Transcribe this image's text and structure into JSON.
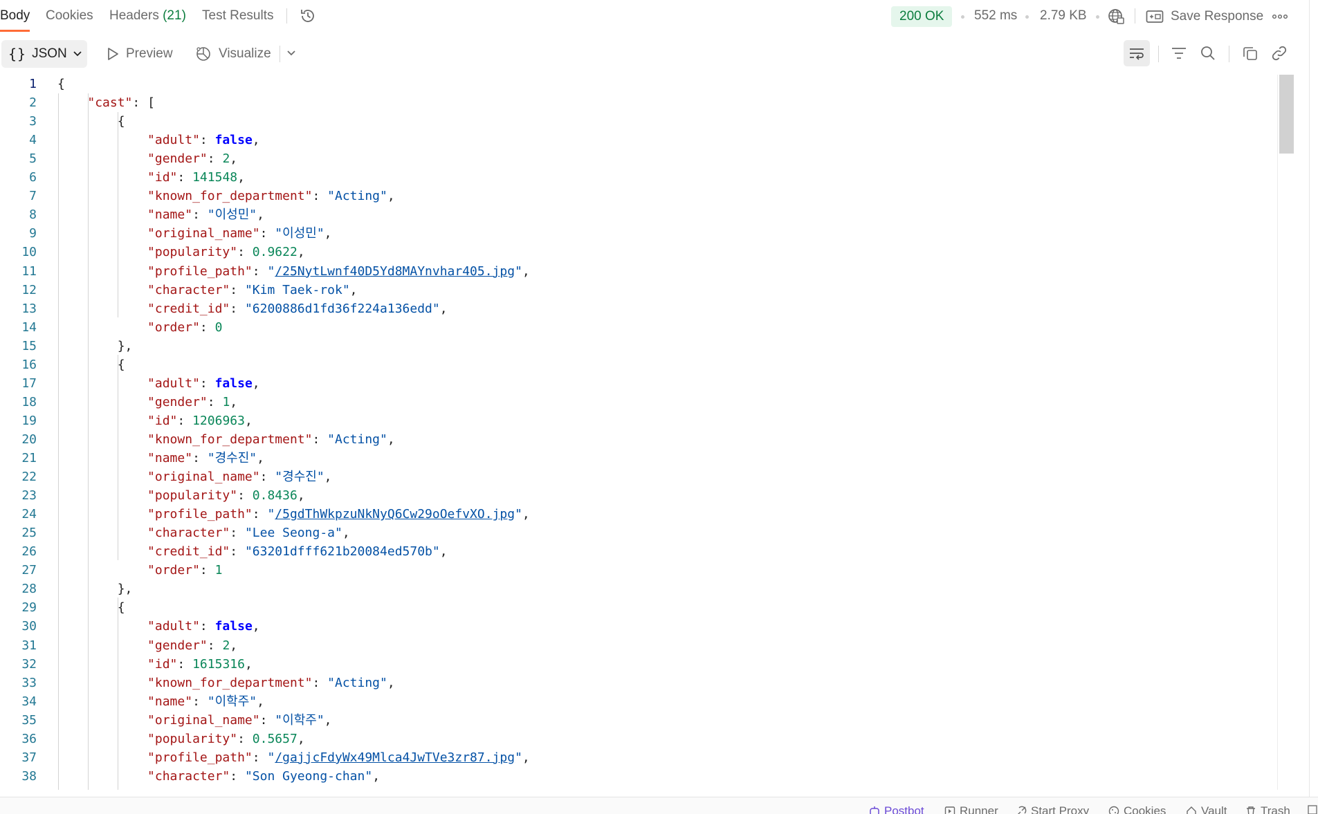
{
  "tabs": {
    "body": "Body",
    "cookies": "Cookies",
    "headers": "Headers",
    "headers_count": "(21)",
    "test_results": "Test Results"
  },
  "response": {
    "status": "200 OK",
    "time": "552 ms",
    "size": "2.79 KB",
    "save_label": "Save Response"
  },
  "toolbar": {
    "format": "JSON",
    "preview": "Preview",
    "visualize": "Visualize"
  },
  "editor": {
    "line_numbers": [
      "1",
      "2",
      "3",
      "4",
      "5",
      "6",
      "7",
      "8",
      "9",
      "10",
      "11",
      "12",
      "13",
      "14",
      "15",
      "16",
      "17",
      "18",
      "19",
      "20",
      "21",
      "22",
      "23",
      "24",
      "25",
      "26",
      "27",
      "28",
      "29",
      "30",
      "31",
      "32",
      "33",
      "34",
      "35",
      "36",
      "37",
      "38"
    ],
    "cast": [
      {
        "adult": "false",
        "gender": "2",
        "id": "141548",
        "known_for_department": "\"Acting\"",
        "name": "\"이성민\"",
        "original_name": "\"이성민\"",
        "popularity": "0.9622",
        "profile_path": "/25NytLwnf40D5Yd8MAYnvhar405.jpg",
        "character": "\"Kim Taek-rok\"",
        "credit_id": "\"6200886d1fd36f224a136edd\"",
        "order": "0"
      },
      {
        "adult": "false",
        "gender": "1",
        "id": "1206963",
        "known_for_department": "\"Acting\"",
        "name": "\"경수진\"",
        "original_name": "\"경수진\"",
        "popularity": "0.8436",
        "profile_path": "/5gdThWkpzuNkNyQ6Cw29oOefvXO.jpg",
        "character": "\"Lee Seong-a\"",
        "credit_id": "\"63201dfff621b20084ed570b\"",
        "order": "1"
      },
      {
        "adult": "false",
        "gender": "2",
        "id": "1615316",
        "known_for_department": "\"Acting\"",
        "name": "\"이학주\"",
        "original_name": "\"이학주\"",
        "popularity": "0.5657",
        "profile_path": "/gajjcFdyWx49Mlca4JwTVe3zr87.jpg",
        "character": "\"Son Gyeong-chan\""
      }
    ]
  },
  "statusbar": {
    "postbot": "Postbot",
    "runner": "Runner",
    "start_proxy": "Start Proxy",
    "cookies": "Cookies",
    "vault": "Vault",
    "trash": "Trash"
  },
  "colors": {
    "accent": "#ff6c37",
    "status_ok_bg": "#e5f6ec",
    "status_ok_text": "#0c7d3e",
    "json_key": "#a31515",
    "json_string": "#0451a5",
    "json_number": "#098658",
    "json_bool": "#0000ff",
    "postbot": "#6b4ad6"
  }
}
